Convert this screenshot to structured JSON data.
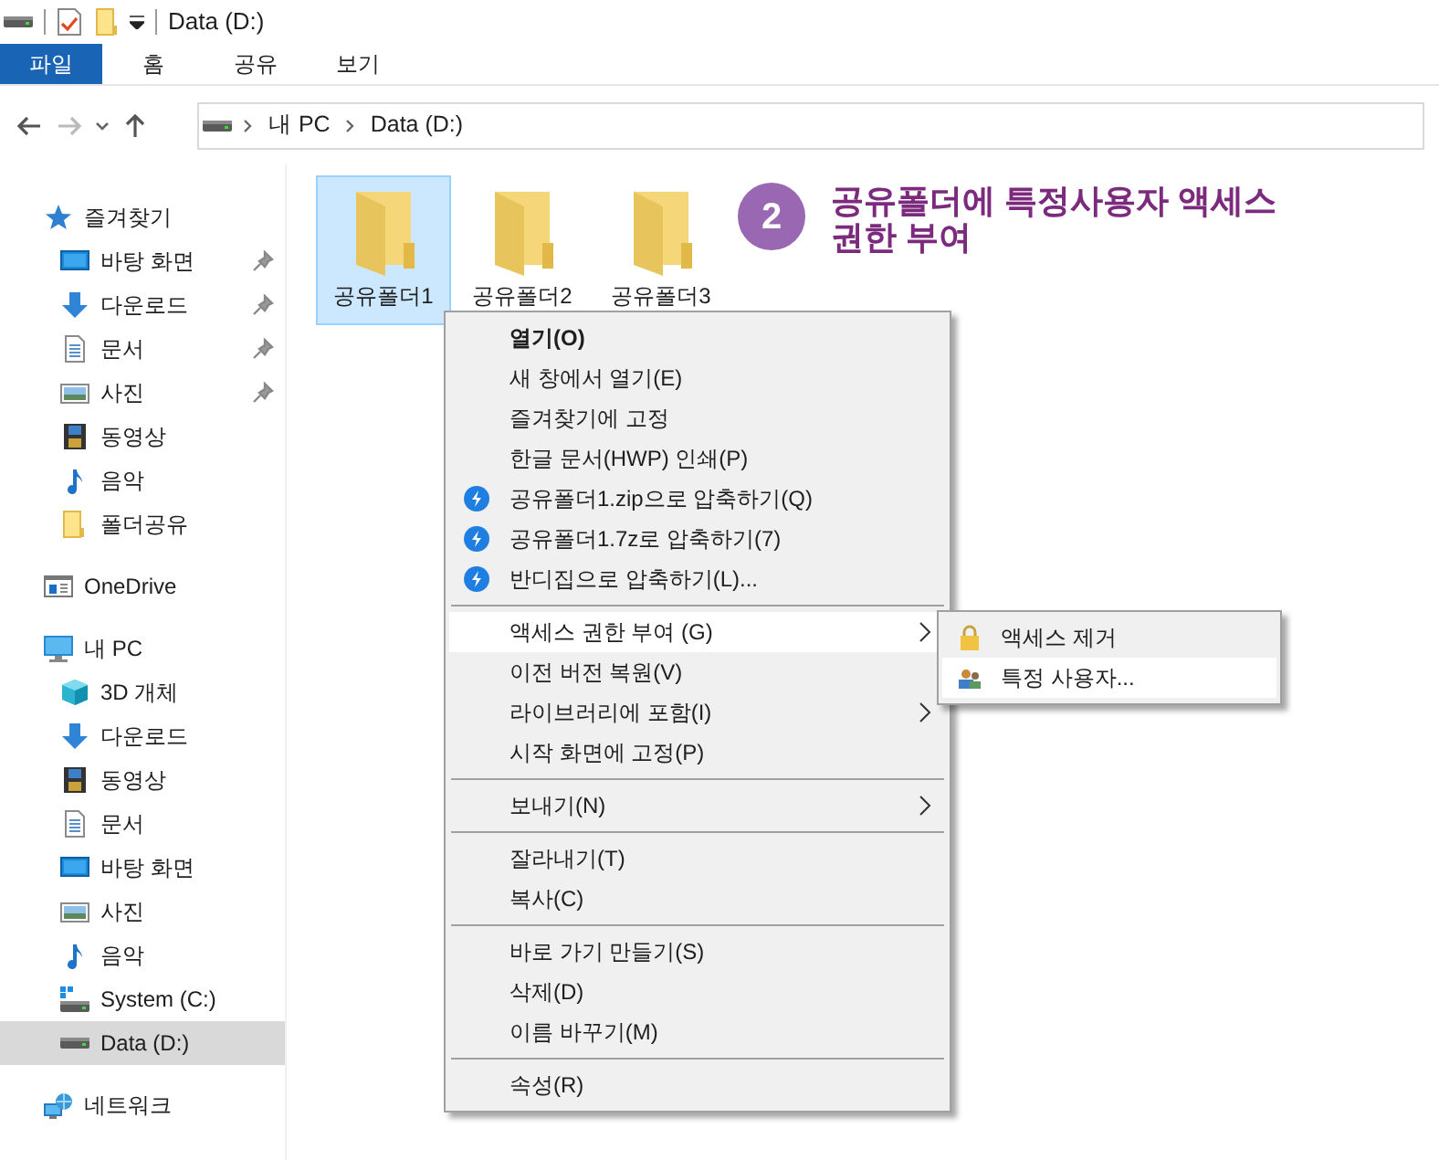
{
  "window": {
    "title": "Data (D:)"
  },
  "ribbon_tabs": [
    {
      "label": "파일",
      "selected": true
    },
    {
      "label": "홈",
      "selected": false
    },
    {
      "label": "공유",
      "selected": false
    },
    {
      "label": "보기",
      "selected": false
    }
  ],
  "address": {
    "back_enabled": true,
    "forward_enabled": false,
    "path": [
      "내 PC",
      "Data (D:)"
    ]
  },
  "sidebar": [
    {
      "label": "즐겨찾기",
      "kind": "star",
      "selected": false,
      "children": [
        {
          "label": "바탕 화면",
          "kind": "desktop",
          "pinned": true,
          "selected": false
        },
        {
          "label": "다운로드",
          "kind": "download",
          "pinned": true,
          "selected": false
        },
        {
          "label": "문서",
          "kind": "document",
          "pinned": true,
          "selected": false
        },
        {
          "label": "사진",
          "kind": "picture",
          "pinned": true,
          "selected": false
        },
        {
          "label": "동영상",
          "kind": "video",
          "pinned": false,
          "selected": false
        },
        {
          "label": "음악",
          "kind": "music",
          "pinned": false,
          "selected": false
        },
        {
          "label": "폴더공유",
          "kind": "folder",
          "pinned": false,
          "selected": false
        }
      ]
    },
    {
      "label": "OneDrive",
      "kind": "cloud",
      "selected": false
    },
    {
      "label": "내 PC",
      "kind": "pc",
      "selected": false,
      "children": [
        {
          "label": "3D 개체",
          "kind": "cube",
          "selected": false
        },
        {
          "label": "다운로드",
          "kind": "download",
          "selected": false
        },
        {
          "label": "동영상",
          "kind": "video",
          "selected": false
        },
        {
          "label": "문서",
          "kind": "document",
          "selected": false
        },
        {
          "label": "바탕 화면",
          "kind": "desktop",
          "selected": false
        },
        {
          "label": "사진",
          "kind": "picture",
          "selected": false
        },
        {
          "label": "음악",
          "kind": "music",
          "selected": false
        },
        {
          "label": "System (C:)",
          "kind": "system",
          "selected": false
        },
        {
          "label": "Data (D:)",
          "kind": "drive",
          "selected": true
        }
      ]
    },
    {
      "label": "네트워크",
      "kind": "network",
      "selected": false
    }
  ],
  "files": [
    {
      "name": "공유폴더1",
      "selected": true
    },
    {
      "name": "공유폴더2",
      "selected": false
    },
    {
      "name": "공유폴더3",
      "selected": false
    }
  ],
  "annotation": {
    "number": "2",
    "text": "공유폴더에 특정사용자 액세스 권한 부여"
  },
  "context_menu": {
    "groups": [
      [
        {
          "label": "열기(O)",
          "bold": true,
          "kind": "plain",
          "selected": false
        },
        {
          "label": "새 창에서 열기(E)",
          "kind": "plain",
          "selected": false
        },
        {
          "label": "즐겨찾기에 고정",
          "kind": "plain",
          "selected": false
        },
        {
          "label": "한글 문서(HWP) 인쇄(P)",
          "kind": "plain",
          "selected": false
        },
        {
          "label": "공유폴더1.zip으로 압축하기(Q)",
          "kind": "compress",
          "selected": false
        },
        {
          "label": "공유폴더1.7z로 압축하기(7)",
          "kind": "compress",
          "selected": false
        },
        {
          "label": "반디집으로 압축하기(L)...",
          "kind": "compress",
          "selected": false
        }
      ],
      [
        {
          "label": "액세스 권한 부여 (G)",
          "kind": "plain",
          "selected": true,
          "submenu": true
        },
        {
          "label": "이전 버전 복원(V)",
          "kind": "plain",
          "selected": false
        },
        {
          "label": "라이브러리에 포함(I)",
          "kind": "plain",
          "selected": false,
          "submenu": true
        },
        {
          "label": "시작 화면에 고정(P)",
          "kind": "plain",
          "selected": false
        }
      ],
      [
        {
          "label": "보내기(N)",
          "kind": "plain",
          "selected": false,
          "submenu": true
        }
      ],
      [
        {
          "label": "잘라내기(T)",
          "kind": "plain",
          "selected": false
        },
        {
          "label": "복사(C)",
          "kind": "plain",
          "selected": false
        }
      ],
      [
        {
          "label": "바로 가기 만들기(S)",
          "kind": "plain",
          "selected": false
        },
        {
          "label": "삭제(D)",
          "kind": "plain",
          "selected": false
        },
        {
          "label": "이름 바꾸기(M)",
          "kind": "plain",
          "selected": false
        }
      ],
      [
        {
          "label": "속성(R)",
          "kind": "plain",
          "selected": false
        }
      ]
    ]
  },
  "submenu": [
    {
      "label": "액세스 제거",
      "kind": "lock",
      "selected": false
    },
    {
      "label": "특정 사용자...",
      "kind": "users",
      "selected": true
    }
  ]
}
